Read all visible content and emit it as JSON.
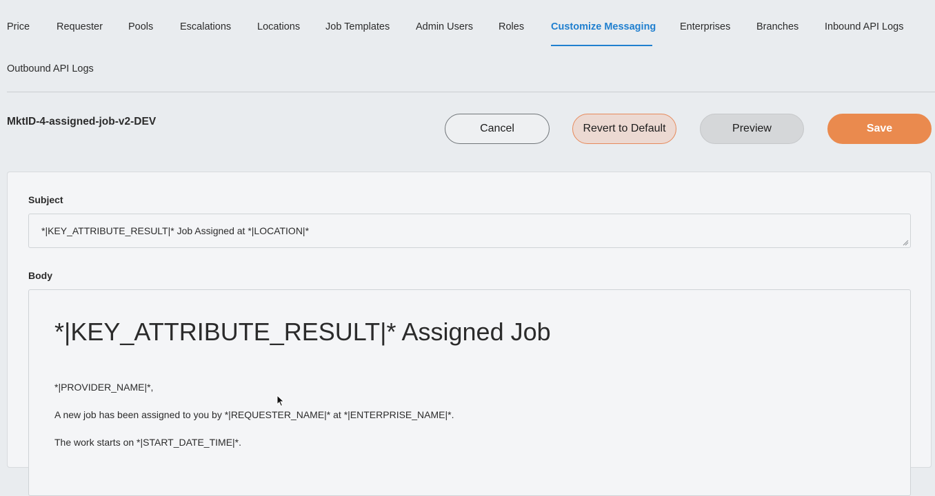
{
  "nav": {
    "tabs": [
      {
        "label": "Price"
      },
      {
        "label": "Requester"
      },
      {
        "label": "Pools"
      },
      {
        "label": "Escalations"
      },
      {
        "label": "Locations"
      },
      {
        "label": "Job Templates"
      },
      {
        "label": "Admin Users"
      },
      {
        "label": "Roles"
      },
      {
        "label": "Customize Messaging",
        "active": true
      },
      {
        "label": "Enterprises"
      },
      {
        "label": "Branches"
      },
      {
        "label": "Inbound API Logs"
      },
      {
        "label": "Outbound API Logs"
      }
    ]
  },
  "header": {
    "title": "MktID-4-assigned-job-v2-DEV"
  },
  "actions": {
    "cancel_label": "Cancel",
    "revert_label": "Revert to Default",
    "preview_label": "Preview",
    "save_label": "Save"
  },
  "form": {
    "subject_label": "Subject",
    "subject_value": "*|KEY_ATTRIBUTE_RESULT|* Job Assigned at *|LOCATION|*",
    "body_label": "Body",
    "body": {
      "heading": "*|KEY_ATTRIBUTE_RESULT|* Assigned Job",
      "line1": "*|PROVIDER_NAME|*,",
      "line2": "A new job has been assigned to you by *|REQUESTER_NAME|* at *|ENTERPRISE_NAME|*.",
      "line3": "The work starts on *|START_DATE_TIME|*."
    }
  },
  "colors": {
    "accent": "#1f7fcf",
    "save": "#ea8a4e",
    "revert_border": "#e6895a"
  }
}
